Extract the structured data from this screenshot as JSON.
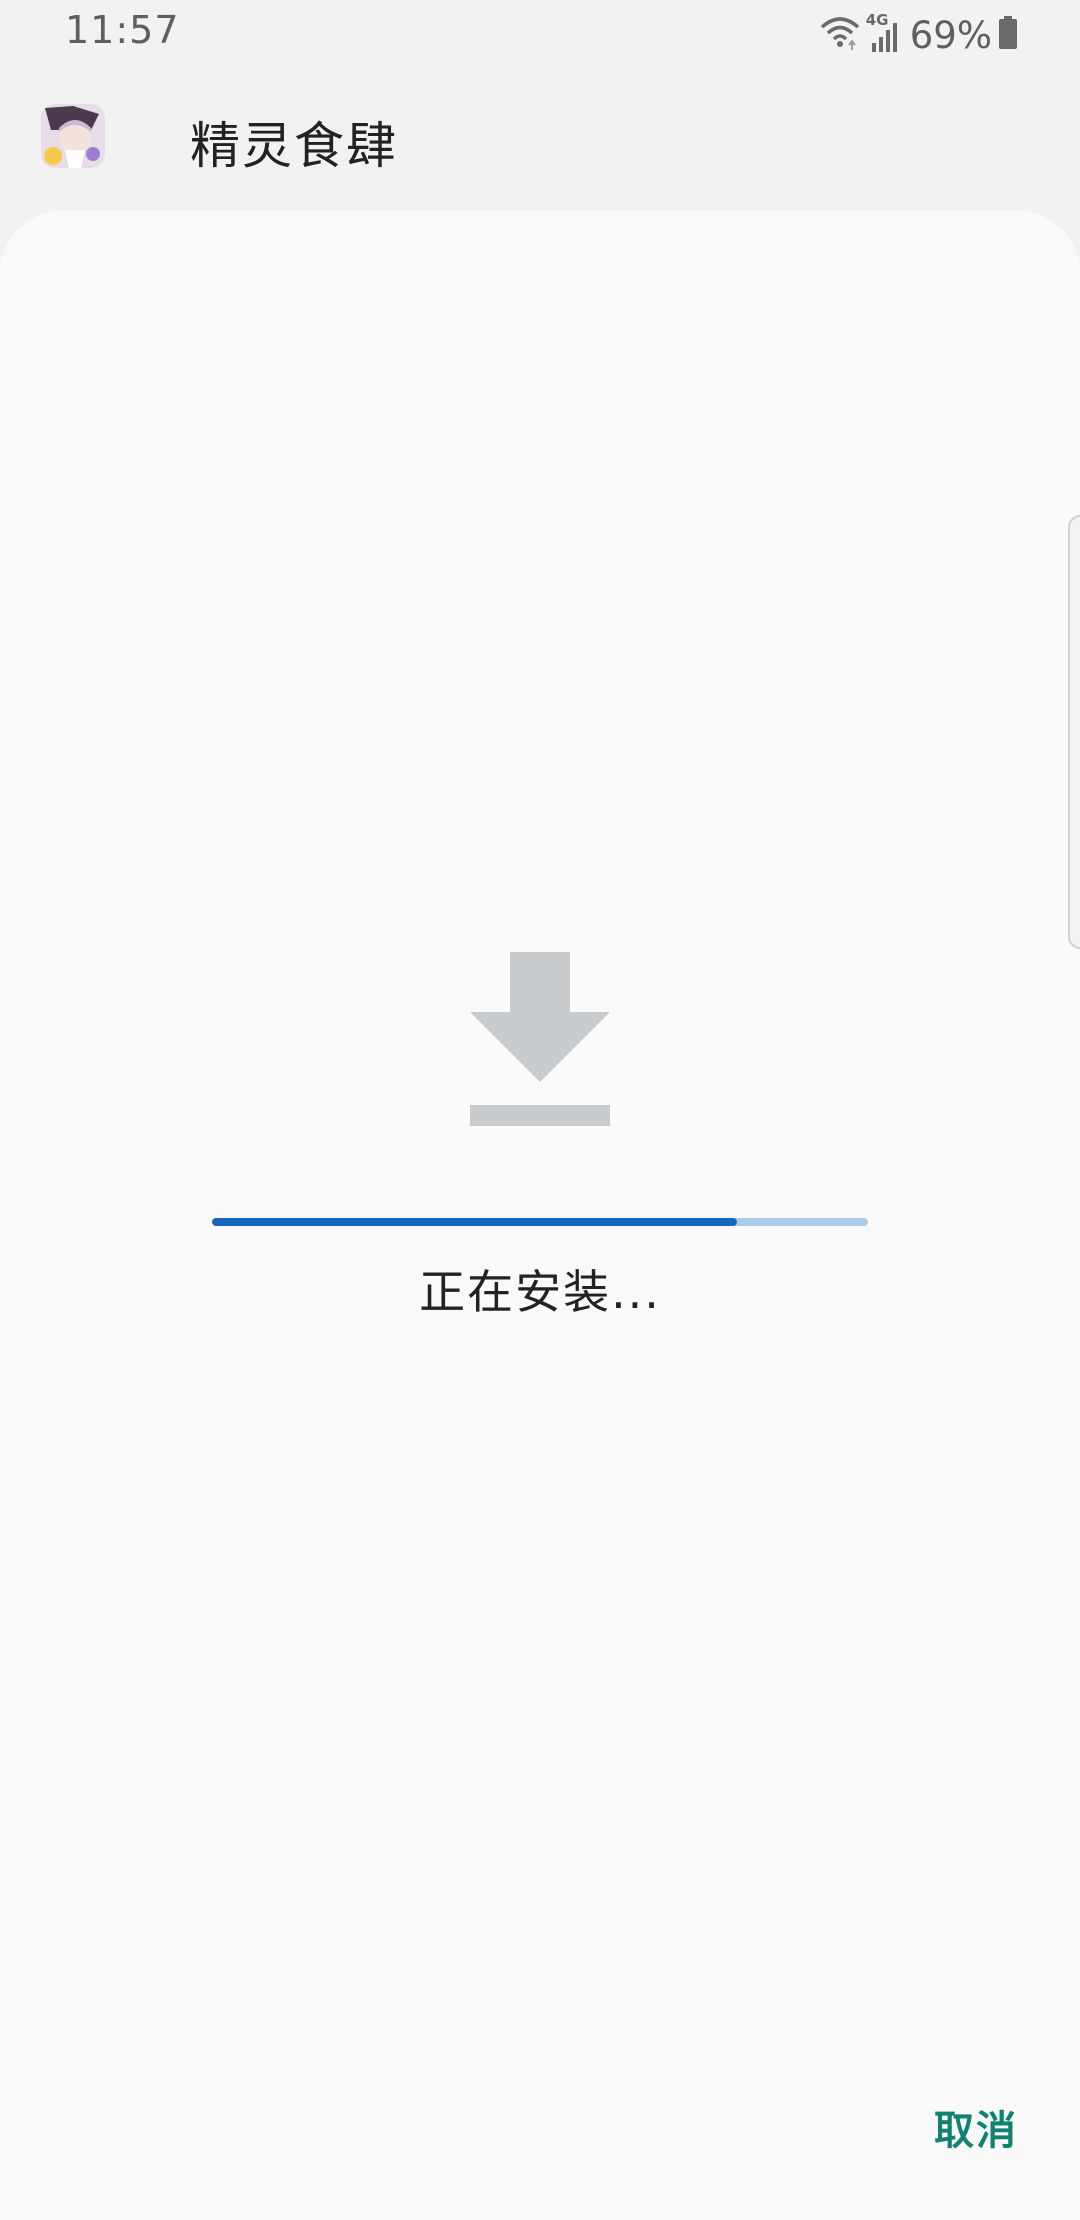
{
  "status_bar": {
    "time": "11:57",
    "network": "4G",
    "battery_percent": "69%",
    "icons": [
      "wifi-icon",
      "signal-icon",
      "battery-icon"
    ]
  },
  "app": {
    "title": "精灵食肆",
    "icon": "app-icon"
  },
  "install": {
    "status_text": "正在安装...",
    "progress": 0.8,
    "icon": "download-icon"
  },
  "actions": {
    "cancel_label": "取消"
  },
  "colors": {
    "progress_fill": "#1666c1",
    "progress_track": "#aecbe6",
    "cancel_text": "#0f8272",
    "icon_gray": "#c9cccf"
  }
}
